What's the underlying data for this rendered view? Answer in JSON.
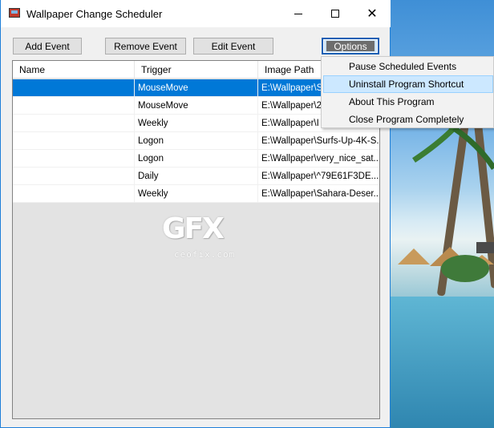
{
  "window": {
    "title": "Wallpaper Change Scheduler"
  },
  "toolbar": {
    "add_label": "Add Event",
    "remove_label": "Remove Event",
    "edit_label": "Edit Event",
    "options_label": "Options"
  },
  "list": {
    "columns": [
      "Name",
      "Trigger",
      "Image Path"
    ],
    "rows": [
      {
        "name": "",
        "trigger": "MouseMove",
        "path": "E:\\Wallpaper\\S"
      },
      {
        "name": "",
        "trigger": "MouseMove",
        "path": "E:\\Wallpaper\\2"
      },
      {
        "name": "",
        "trigger": "Weekly",
        "path": "E:\\Wallpaper\\I"
      },
      {
        "name": "",
        "trigger": "Logon",
        "path": "E:\\Wallpaper\\Surfs-Up-4K-S..."
      },
      {
        "name": "",
        "trigger": "Logon",
        "path": "E:\\Wallpaper\\very_nice_sat..."
      },
      {
        "name": "",
        "trigger": "Daily",
        "path": "E:\\Wallpaper\\^79E61F3DE..."
      },
      {
        "name": "",
        "trigger": "Weekly",
        "path": "E:\\Wallpaper\\Sahara-Deser..."
      }
    ],
    "selected_row": 0
  },
  "menu": {
    "items": [
      {
        "label": "Pause Scheduled Events"
      },
      {
        "label": "Uninstall Program Shortcut"
      },
      {
        "label": "About This Program"
      },
      {
        "label": "Close Program Completely"
      }
    ],
    "hovered_item": 1
  },
  "watermark": {
    "logo": "GFX",
    "site": "ceofix.com"
  },
  "colors": {
    "selection": "#0078d7",
    "menu_hover": "#cce8ff",
    "window_border": "#1e7fd8"
  }
}
